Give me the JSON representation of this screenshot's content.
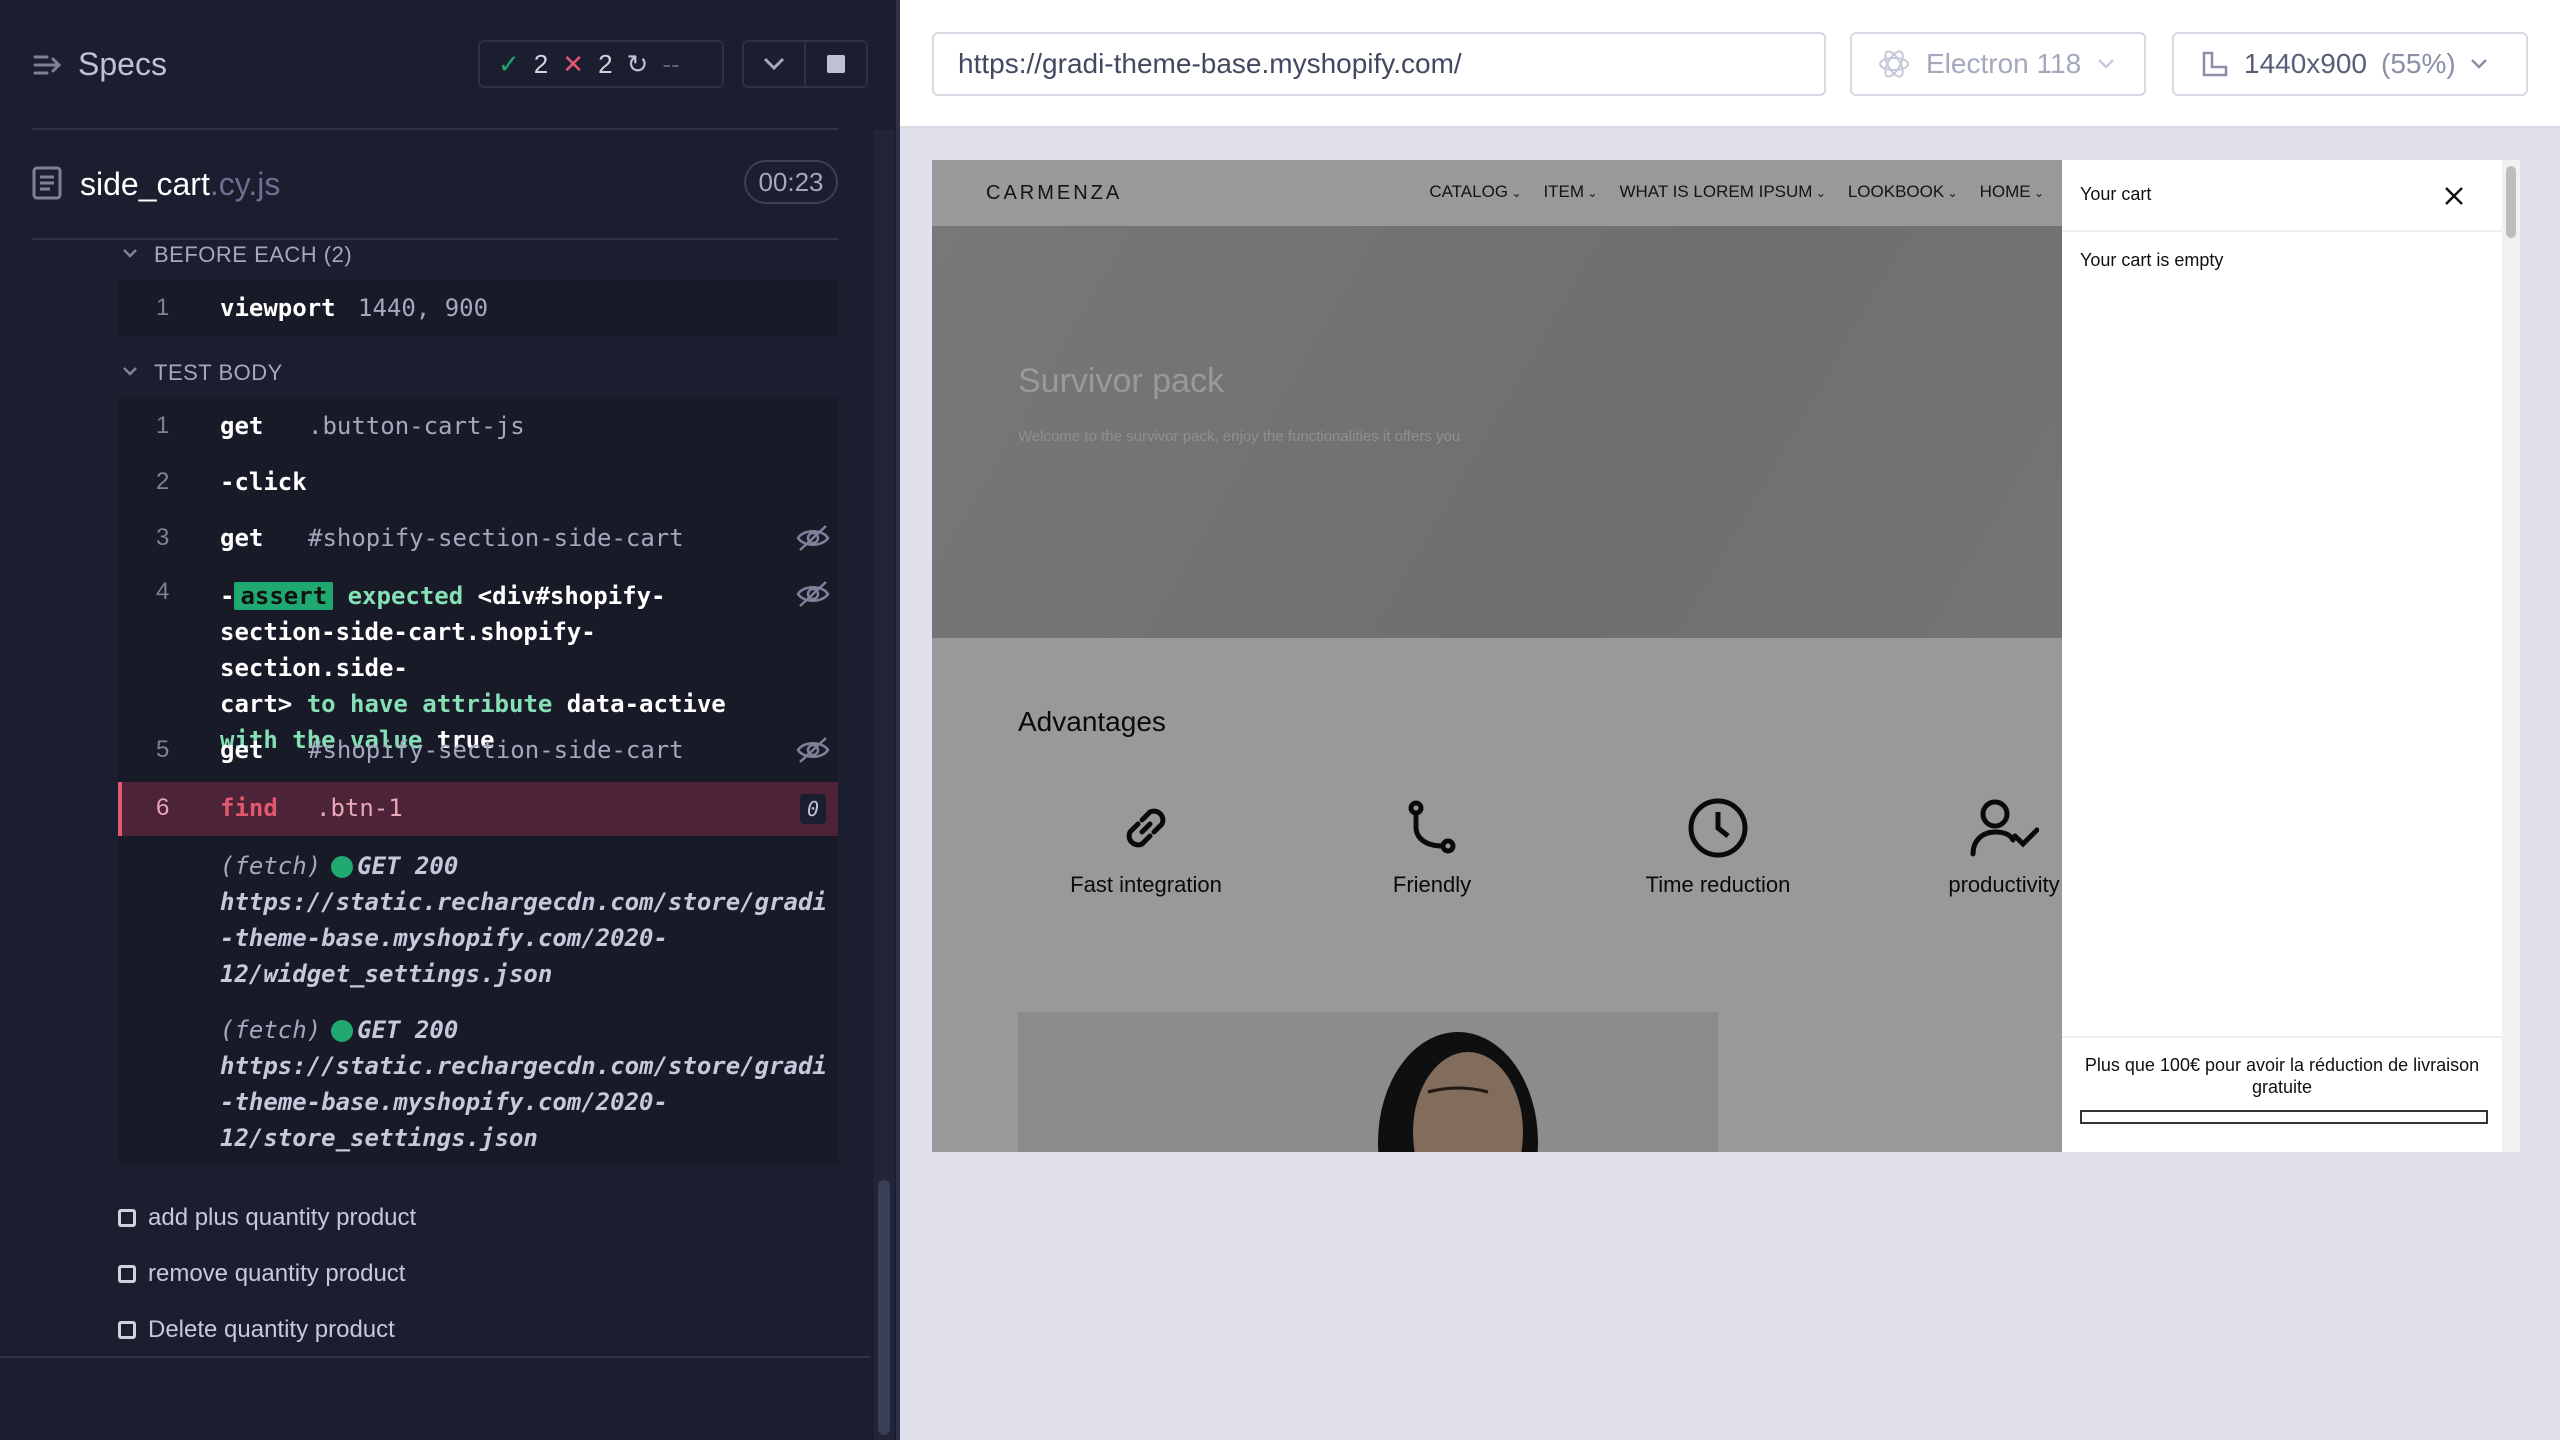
{
  "reporter": {
    "title": "Specs",
    "stats": {
      "passed": "2",
      "failed": "2",
      "pending": "--"
    },
    "spec": {
      "name": "side_cart",
      "ext": ".cy.js",
      "duration": "00:23"
    },
    "before_each": {
      "label": "BEFORE EACH (2)",
      "commands": [
        {
          "num": "1",
          "name": "viewport",
          "msg": "1440, 900"
        }
      ]
    },
    "test_body": {
      "label": "TEST BODY",
      "commands": [
        {
          "num": "1",
          "name": "get",
          "msg": ".button-cart-js"
        },
        {
          "num": "2",
          "name": "-click",
          "msg": ""
        },
        {
          "num": "3",
          "name": "get",
          "msg": "#shopify-section-side-cart"
        },
        {
          "num": "4",
          "name": "-assert",
          "msg_l1": "expected",
          "msg_l1b": "<div#shopify-",
          "msg_l2": "section-side-cart.shopify-section.side-",
          "msg_l3a": "cart>",
          "msg_l3b": "to have attribute",
          "msg_l3c": "data-active",
          "msg_l4a": "with the value",
          "msg_l4b": "true"
        },
        {
          "num": "5",
          "name": "get",
          "msg": "#shopify-section-side-cart"
        },
        {
          "num": "6",
          "name": "find",
          "msg": ".btn-1",
          "badge": "0"
        }
      ],
      "fetches": [
        {
          "tag": "(fetch)",
          "method": "GET 200",
          "l1": "https://static.rechargecdn.com/store/gradi",
          "l2": "-theme-base.myshopify.com/2020-",
          "l3": "12/widget_settings.json"
        },
        {
          "tag": "(fetch)",
          "method": "GET 200",
          "l1": "https://static.rechargecdn.com/store/gradi",
          "l2": "-theme-base.myshopify.com/2020-",
          "l3": "12/store_settings.json"
        }
      ]
    },
    "tests": [
      "add plus quantity product",
      "remove quantity product",
      "Delete quantity product"
    ]
  },
  "browser": {
    "url": "https://gradi-theme-base.myshopify.com/",
    "engine": "Electron 118",
    "viewport": "1440x900",
    "scale": "(55%)"
  },
  "shop": {
    "logo": "CARMENZA",
    "nav": [
      "CATALOG",
      "ITEM",
      "WHAT IS LOREM IPSUM",
      "LOOKBOOK",
      "HOME"
    ],
    "hero_title": "Survivor pack",
    "hero_sub": "Welcome to the survivor pack, enjoy the functionalities it offers you",
    "advantages_title": "Advantages",
    "features": [
      "Fast integration",
      "Friendly",
      "Time reduction",
      "productivity"
    ]
  },
  "cart": {
    "title": "Your cart",
    "empty": "Your cart is empty",
    "shipping_msg": "Plus que 100€ pour avoir la réduction de livraison gratuite"
  },
  "colors": {
    "pass": "#1fa971",
    "fail": "#e45770",
    "bg": "#1b1e2e"
  }
}
